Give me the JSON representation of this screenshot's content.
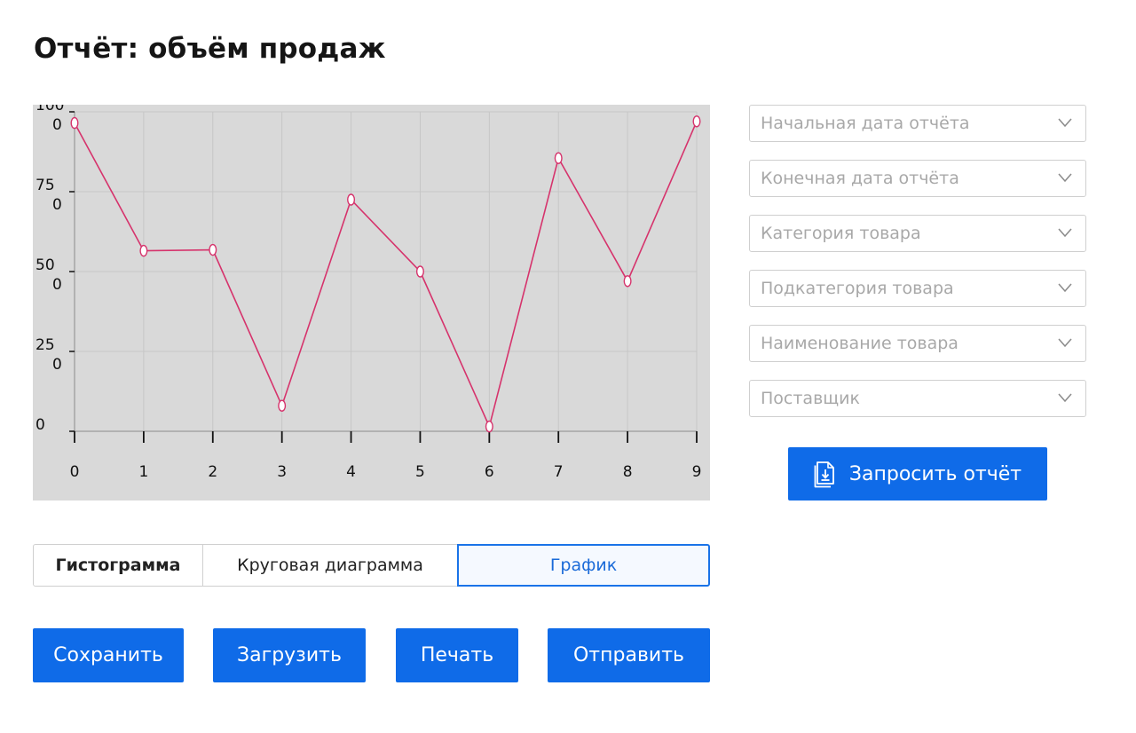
{
  "header": {
    "title": "Отчёт: объём продаж"
  },
  "chart_data": {
    "type": "line",
    "x": [
      0,
      1,
      2,
      3,
      4,
      5,
      6,
      7,
      8,
      9
    ],
    "values": [
      965,
      565,
      568,
      80,
      725,
      500,
      15,
      855,
      470,
      970
    ],
    "ylim": [
      0,
      1000
    ],
    "y_ticks": [
      0,
      250,
      500,
      750,
      1000
    ],
    "y_tick_labels": [
      [
        "0",
        ""
      ],
      [
        "25",
        "0"
      ],
      [
        "50",
        "0"
      ],
      [
        "75",
        "0"
      ],
      [
        "100",
        "0"
      ]
    ],
    "x_ticks": [
      0,
      1,
      2,
      3,
      4,
      5,
      6,
      7,
      8,
      9
    ],
    "x_tick_labels": [
      "0",
      "1",
      "2",
      "3",
      "4",
      "5",
      "6",
      "7",
      "8",
      "9"
    ],
    "grid": true,
    "line_color": "#d6336c",
    "marker_fill": "#ffffff",
    "background_color": "#d9d9d9"
  },
  "filters": [
    {
      "placeholder": "Начальная дата отчёта"
    },
    {
      "placeholder": "Конечная дата отчёта"
    },
    {
      "placeholder": "Категория товара"
    },
    {
      "placeholder": "Подкатегория товара"
    },
    {
      "placeholder": "Наименование товара"
    },
    {
      "placeholder": "Поставщик"
    }
  ],
  "request_button": {
    "label": "Запросить отчёт",
    "icon": "document-download-icon"
  },
  "chart_tabs": [
    {
      "label": "Гистограмма"
    },
    {
      "label": "Круговая диаграмма"
    },
    {
      "label": "График",
      "selected": true
    }
  ],
  "actions": {
    "save": "Сохранить",
    "upload": "Загрузить",
    "print": "Печать",
    "send": "Отправить"
  },
  "colors": {
    "primary": "#0f6be8",
    "accent_border": "#1a73e8",
    "placeholder_text": "#a8a8a8"
  }
}
